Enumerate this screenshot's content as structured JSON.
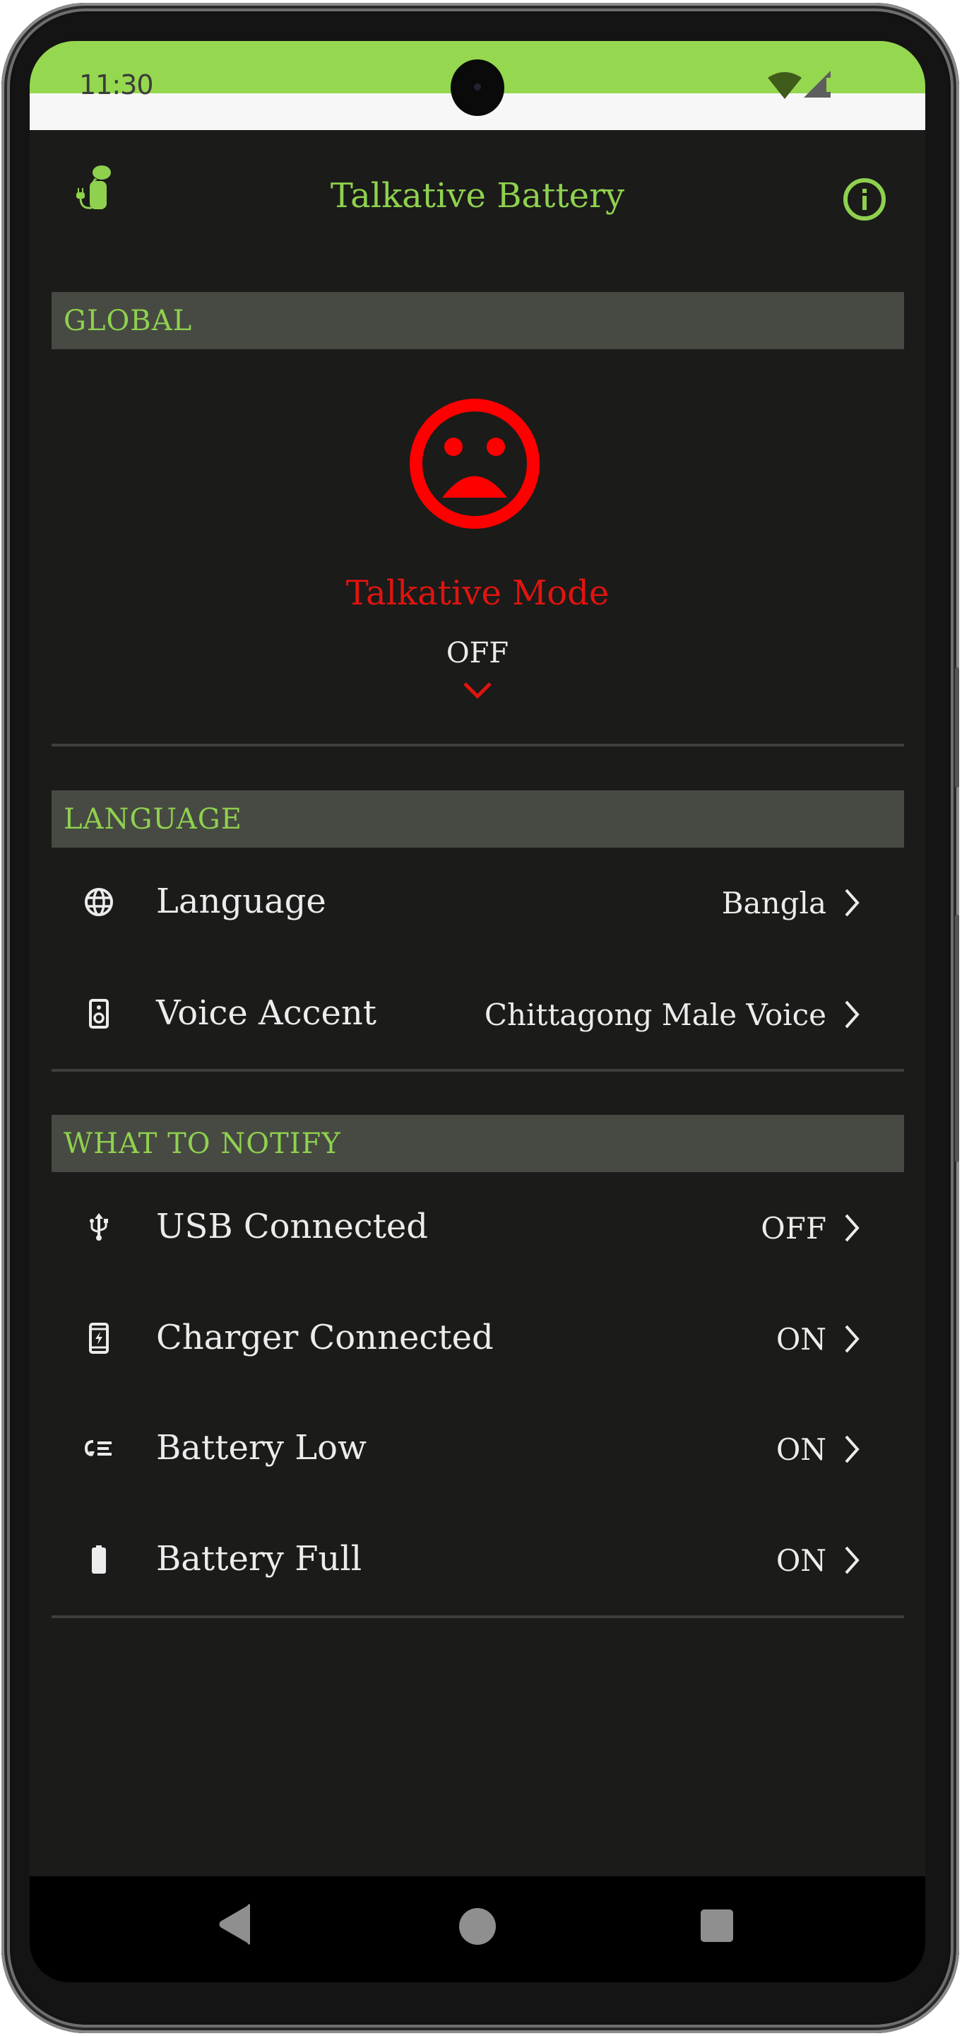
{
  "status_bar": {
    "time": "11:30",
    "icons": [
      "wifi-icon",
      "cellular-signal-icon"
    ]
  },
  "app": {
    "title": "Talkative Battery",
    "logo_icon": "talking-battery-plug-icon",
    "info_icon": "info-icon"
  },
  "colors": {
    "accent": "#8fd14f",
    "status_bar": "#95d84f",
    "background": "#1b1b19",
    "section_header_bg": "#474a42",
    "off_red": "#e0140f",
    "text": "#ececec"
  },
  "sections": {
    "global": {
      "header": "GLOBAL",
      "mode": {
        "icon": "sad-face-icon",
        "title": "Talkative Mode",
        "state": "OFF",
        "expand_icon": "chevron-down-icon"
      }
    },
    "language": {
      "header": "LANGUAGE",
      "items": [
        {
          "icon": "globe-icon",
          "label": "Language",
          "value": "Bangla"
        },
        {
          "icon": "speaker-icon",
          "label": "Voice Accent",
          "value": "Chittagong Male Voice"
        }
      ]
    },
    "notify": {
      "header": "WHAT TO NOTIFY",
      "items": [
        {
          "icon": "usb-icon",
          "label": "USB Connected",
          "value": "OFF"
        },
        {
          "icon": "phone-charging-icon",
          "label": "Charger Connected",
          "value": "ON"
        },
        {
          "icon": "battery-low-icon",
          "label": "Battery Low",
          "value": "ON"
        },
        {
          "icon": "battery-full-icon",
          "label": "Battery Full",
          "value": "ON"
        }
      ]
    }
  },
  "nav_bar": {
    "buttons": [
      "back",
      "home",
      "recents"
    ]
  }
}
